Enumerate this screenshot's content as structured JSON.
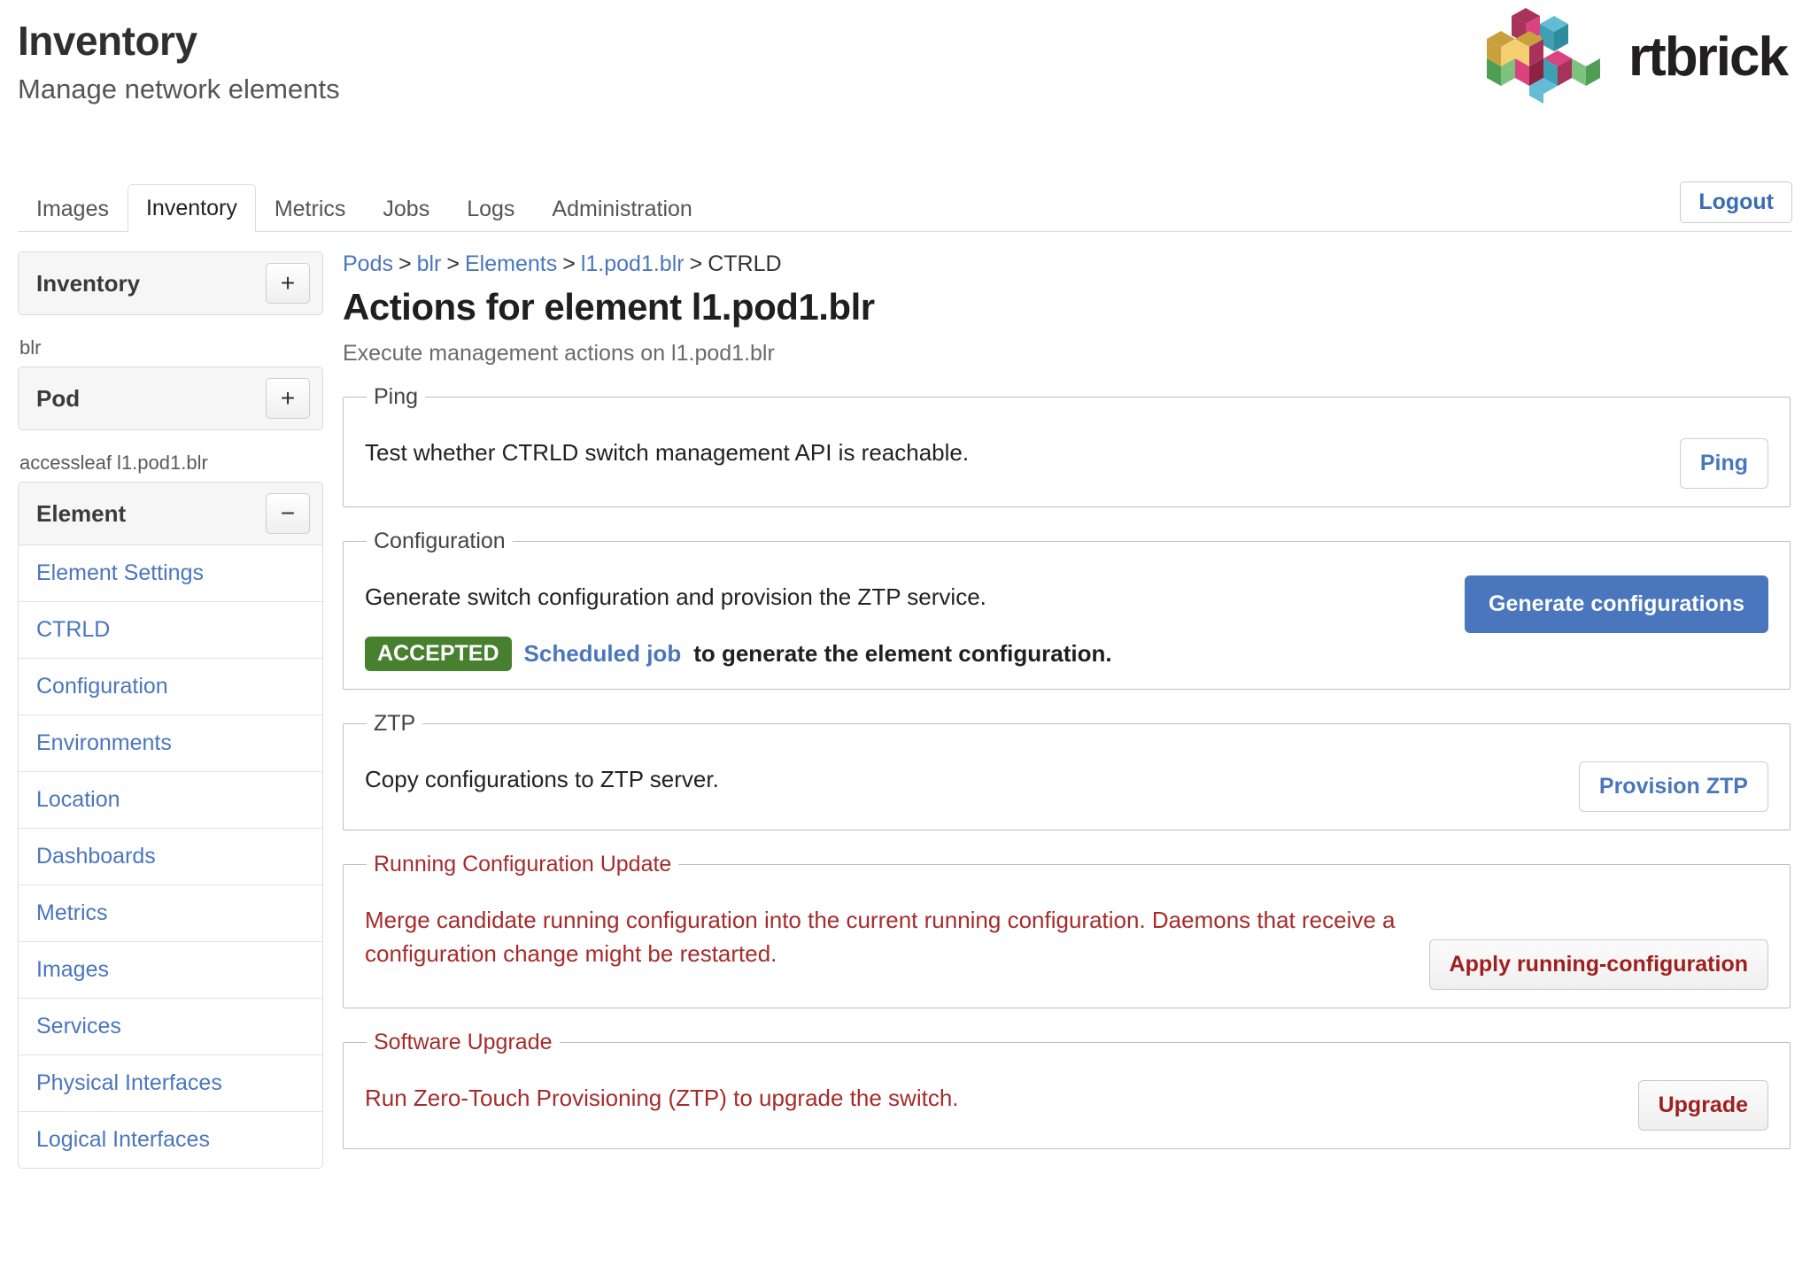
{
  "header": {
    "title": "Inventory",
    "subtitle": "Manage network elements",
    "brand_name": "rtbrick",
    "brand_logo_icon": "rtbrick-isometric-cubes-logo"
  },
  "tabs": [
    {
      "label": "Images",
      "active": false
    },
    {
      "label": "Inventory",
      "active": true
    },
    {
      "label": "Metrics",
      "active": false
    },
    {
      "label": "Jobs",
      "active": false
    },
    {
      "label": "Logs",
      "active": false
    },
    {
      "label": "Administration",
      "active": false
    }
  ],
  "logout": {
    "label": "Logout"
  },
  "sidebar": {
    "panels": [
      {
        "title": "Inventory",
        "toggle": "+",
        "toggle_icon": "plus-icon"
      },
      {
        "title": "Pod",
        "toggle": "+",
        "toggle_icon": "plus-icon",
        "group_label": "blr"
      },
      {
        "title": "Element",
        "toggle": "−",
        "toggle_icon": "minus-icon",
        "group_label": "accessleaf l1.pod1.blr"
      }
    ],
    "element_nav": [
      {
        "label": "Element Settings"
      },
      {
        "label": "CTRLD"
      },
      {
        "label": "Configuration"
      },
      {
        "label": "Environments"
      },
      {
        "label": "Location"
      },
      {
        "label": "Dashboards"
      },
      {
        "label": "Metrics"
      },
      {
        "label": "Images"
      },
      {
        "label": "Services"
      },
      {
        "label": "Physical Interfaces"
      },
      {
        "label": "Logical Interfaces"
      }
    ]
  },
  "breadcrumb": {
    "items": [
      {
        "label": "Pods",
        "link": true
      },
      {
        "label": "blr",
        "link": true
      },
      {
        "label": "Elements",
        "link": true
      },
      {
        "label": "l1.pod1.blr",
        "link": true
      },
      {
        "label": "CTRLD",
        "link": false
      }
    ],
    "separator": ">"
  },
  "page": {
    "title": "Actions for element l1.pod1.blr",
    "description": "Execute management actions on l1.pod1.blr"
  },
  "sections": {
    "ping": {
      "legend": "Ping",
      "text": "Test whether CTRLD switch management API is reachable.",
      "button": "Ping"
    },
    "configuration": {
      "legend": "Configuration",
      "text": "Generate switch configuration and provision the ZTP service.",
      "button": "Generate configurations",
      "status_badge": "ACCEPTED",
      "status_link": "Scheduled job",
      "status_text": "to generate the element configuration."
    },
    "ztp": {
      "legend": "ZTP",
      "text": "Copy configurations to ZTP server.",
      "button": "Provision ZTP"
    },
    "running_config_update": {
      "legend": "Running Configuration Update",
      "text": "Merge candidate running configuration into the current running configuration. Daemons that receive a configuration change might be restarted.",
      "button": "Apply running-configuration"
    },
    "software_upgrade": {
      "legend": "Software Upgrade",
      "text": "Run Zero-Touch Provisioning (ZTP) to upgrade the switch.",
      "button": "Upgrade"
    }
  },
  "colors": {
    "link": "#4a76bd",
    "primary_button": "#4a76bd",
    "accepted_badge": "#47802f",
    "danger_text": "#a62b2b",
    "danger_button_text": "#9e1f1f"
  }
}
